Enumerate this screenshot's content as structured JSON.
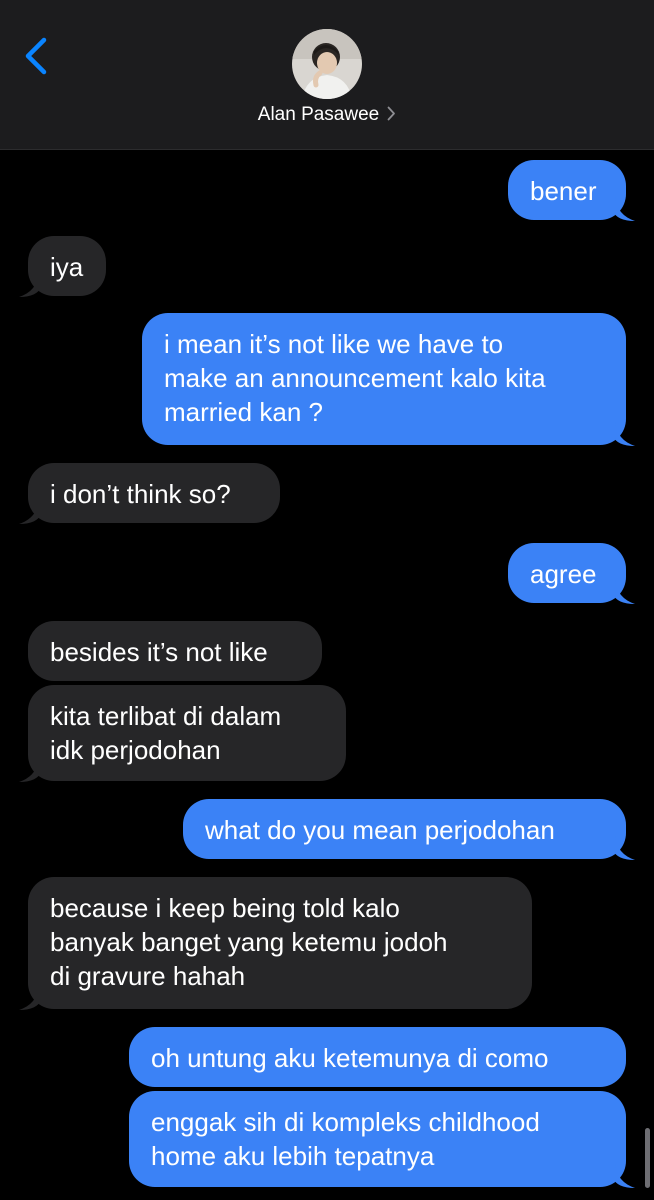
{
  "header": {
    "contact_name": "Alan Pasawee"
  },
  "colors": {
    "outgoing_bubble": "#3b82f6",
    "incoming_bubble": "#262628",
    "accent": "#0a84ff",
    "header_bg": "#1c1c1e"
  },
  "messages": [
    {
      "direction": "outgoing",
      "lines": [
        "bener"
      ]
    },
    {
      "direction": "incoming",
      "lines": [
        "iya"
      ]
    },
    {
      "direction": "outgoing",
      "lines": [
        "i mean it’s not like we have to",
        "make an announcement kalo kita",
        "married kan ?"
      ]
    },
    {
      "direction": "incoming",
      "lines": [
        "i don’t think so?"
      ]
    },
    {
      "direction": "outgoing",
      "lines": [
        "agree"
      ]
    },
    {
      "direction": "incoming",
      "lines": [
        "besides it’s not like"
      ]
    },
    {
      "direction": "incoming",
      "lines": [
        "kita terlibat di dalam",
        "idk perjodohan"
      ]
    },
    {
      "direction": "outgoing",
      "lines": [
        "what do you mean perjodohan"
      ]
    },
    {
      "direction": "incoming",
      "lines": [
        "because i keep being told kalo",
        "banyak banget yang ketemu jodoh",
        "di gravure hahah"
      ]
    },
    {
      "direction": "outgoing",
      "lines": [
        "oh untung aku ketemunya di como"
      ]
    },
    {
      "direction": "outgoing",
      "lines": [
        "enggak sih di kompleks childhood",
        "home aku lebih tepatnya"
      ]
    }
  ]
}
